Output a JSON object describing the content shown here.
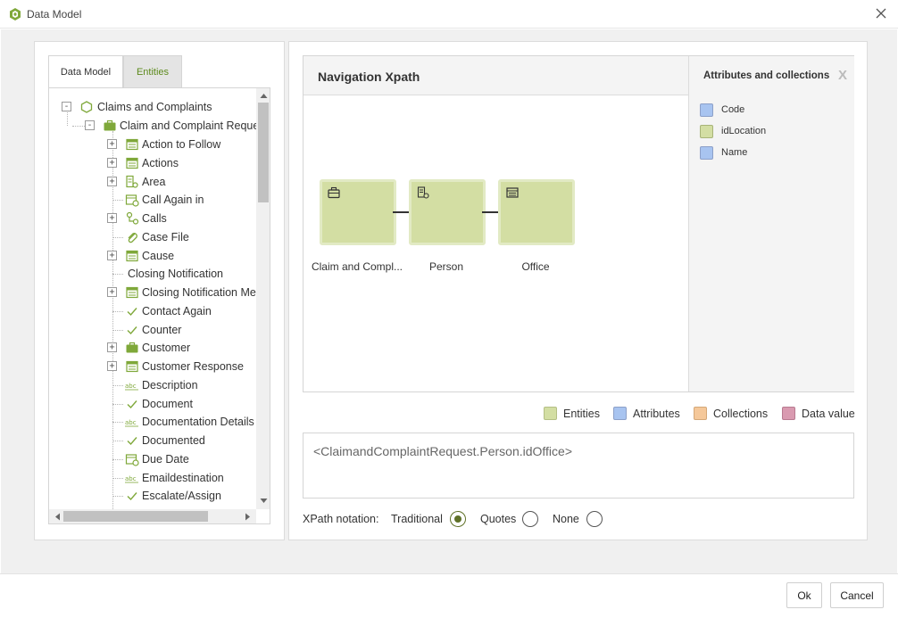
{
  "window": {
    "title": "Data Model",
    "close_icon": "close-icon"
  },
  "tabs": [
    {
      "label": "Data Model",
      "active": true
    },
    {
      "label": "Entities",
      "active": false
    }
  ],
  "tree": {
    "root": "Claims and Complaints",
    "entity": "Claim and Complaint Request",
    "items": [
      {
        "label": "Action to Follow",
        "icon": "table-icon",
        "expandable": true
      },
      {
        "label": "Actions",
        "icon": "table-icon",
        "expandable": true
      },
      {
        "label": "Area",
        "icon": "doc-gear-icon",
        "expandable": true
      },
      {
        "label": "Call Again in",
        "icon": "calendar-icon",
        "expandable": false
      },
      {
        "label": "Calls",
        "icon": "relation-icon",
        "expandable": true
      },
      {
        "label": "Case File",
        "icon": "paperclip-icon",
        "expandable": false
      },
      {
        "label": "Cause",
        "icon": "table-icon",
        "expandable": true
      },
      {
        "label": "Closing Notification",
        "icon": "",
        "expandable": false
      },
      {
        "label": "Closing Notification Me",
        "icon": "table-icon",
        "expandable": true
      },
      {
        "label": "Contact Again",
        "icon": "check-icon",
        "expandable": false
      },
      {
        "label": "Counter",
        "icon": "check-icon",
        "expandable": false
      },
      {
        "label": "Customer",
        "icon": "briefcase-icon",
        "expandable": true
      },
      {
        "label": "Customer Response",
        "icon": "table-icon",
        "expandable": true
      },
      {
        "label": "Description",
        "icon": "abc-icon",
        "expandable": false
      },
      {
        "label": "Document",
        "icon": "check-icon",
        "expandable": false
      },
      {
        "label": "Documentation Details",
        "icon": "abc-icon",
        "expandable": false
      },
      {
        "label": "Documented",
        "icon": "check-icon",
        "expandable": false
      },
      {
        "label": "Due Date",
        "icon": "calendar-icon",
        "expandable": false
      },
      {
        "label": "Emaildestination",
        "icon": "abc-icon",
        "expandable": false
      },
      {
        "label": "Escalate/Assign",
        "icon": "check-icon",
        "expandable": false
      }
    ]
  },
  "navigation": {
    "title": "Navigation Xpath",
    "nodes": [
      {
        "label": "Claim and Compl...",
        "icon": "briefcase-icon"
      },
      {
        "label": "Person",
        "icon": "doc-gear-icon"
      },
      {
        "label": "Office",
        "icon": "table-icon"
      }
    ]
  },
  "attributes": {
    "title": "Attributes and collections",
    "close": "X",
    "items": [
      {
        "label": "Code",
        "color": "#a8c4f0"
      },
      {
        "label": "idLocation",
        "color": "#d3dea3"
      },
      {
        "label": "Name",
        "color": "#a8c4f0"
      }
    ]
  },
  "legend": [
    {
      "label": "Entities",
      "color": "#d3dea3"
    },
    {
      "label": "Attributes",
      "color": "#a8c4f0"
    },
    {
      "label": "Collections",
      "color": "#f5c89a"
    },
    {
      "label": "Data value",
      "color": "#d99ab0"
    }
  ],
  "expression": "<ClaimandComplaintRequest.Person.idOffice>",
  "notation": {
    "label": "XPath notation:",
    "options": [
      {
        "label": "Traditional",
        "selected": true
      },
      {
        "label": "Quotes",
        "selected": false
      },
      {
        "label": "None",
        "selected": false
      }
    ]
  },
  "buttons": {
    "ok": "Ok",
    "cancel": "Cancel"
  },
  "colors": {
    "accent": "#5d8a1c",
    "entity": "#d3dea3"
  }
}
